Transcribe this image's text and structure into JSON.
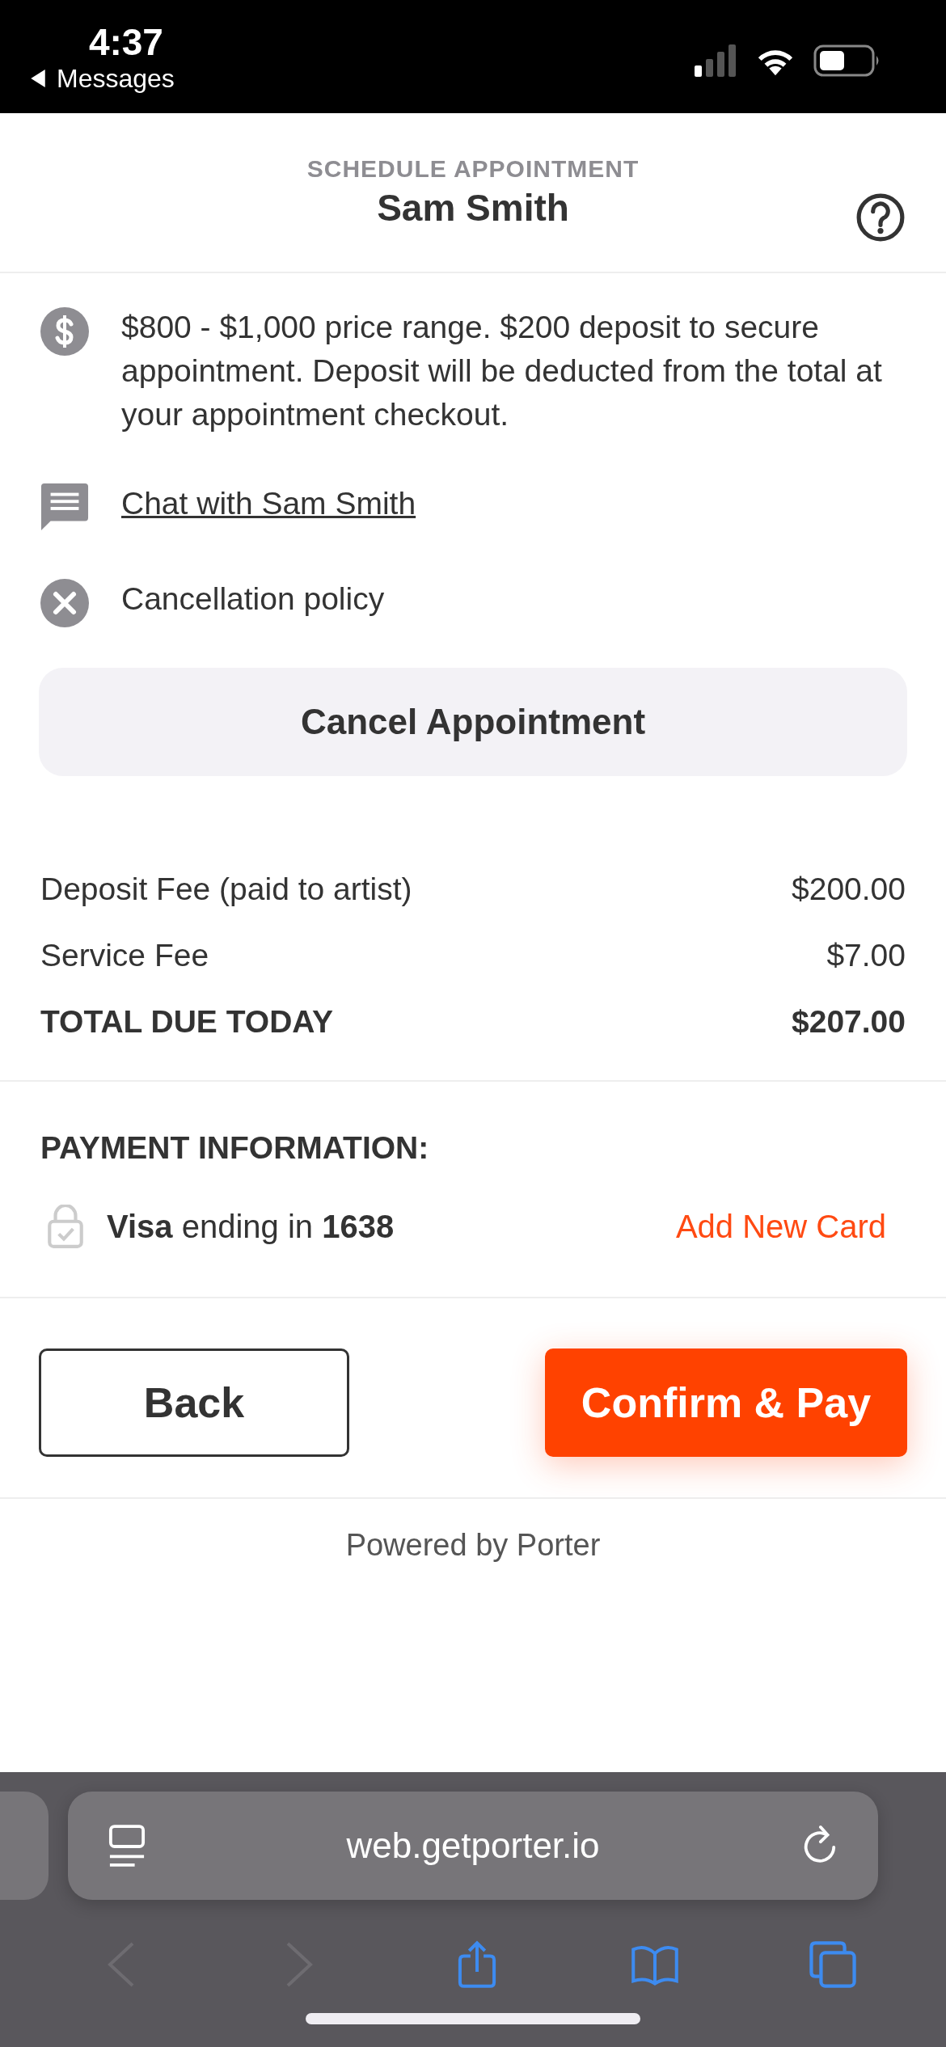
{
  "status_bar": {
    "time": "4:37",
    "back_label": "Messages"
  },
  "header": {
    "subtitle": "SCHEDULE APPOINTMENT",
    "title": "Sam Smith"
  },
  "info_items": [
    {
      "kind": "price",
      "text": "$800 - $1,000 price range. $200 deposit to secure appointment. Deposit will be deducted from the total at your appointment checkout."
    },
    {
      "kind": "chat",
      "text": "Chat with Sam Smith"
    },
    {
      "kind": "cancel",
      "text": "Cancellation policy"
    }
  ],
  "cancel_button": "Cancel Appointment",
  "fees": [
    {
      "label": "Deposit Fee (paid to artist)",
      "amount": "$200.00",
      "total": false
    },
    {
      "label": "Service Fee",
      "amount": "$7.00",
      "total": false
    },
    {
      "label": "TOTAL DUE TODAY",
      "amount": "$207.00",
      "total": true
    }
  ],
  "payment": {
    "heading": "PAYMENT INFORMATION:",
    "card": "**Visa** ending in **1638**",
    "add_card": "Add New Card"
  },
  "actions": {
    "back": "Back",
    "confirm": "Confirm & Pay"
  },
  "footer": "Powered by Porter",
  "browser": {
    "url": "web.getporter.io",
    "toolbar": [
      {
        "kind": "back",
        "disabled": true
      },
      {
        "kind": "forward",
        "disabled": true
      },
      {
        "kind": "share",
        "disabled": false
      },
      {
        "kind": "bookmarks",
        "disabled": false
      },
      {
        "kind": "tabs",
        "disabled": false
      }
    ]
  }
}
